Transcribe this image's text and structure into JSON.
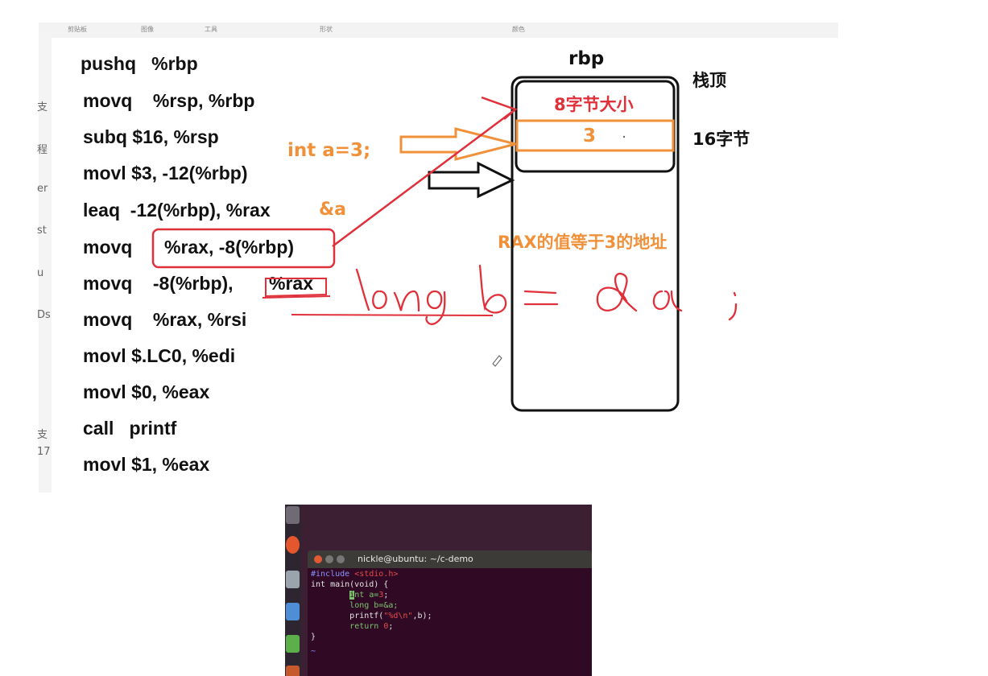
{
  "ribbon": {
    "groups": [
      "剪贴板",
      "图像",
      "工具",
      "形状",
      "颜色"
    ]
  },
  "sidebar_fragments": [
    "支",
    "程",
    "er",
    "st",
    "u",
    "Ds",
    "支",
    "17"
  ],
  "assembly": [
    "pushq   %rbp",
    "movq    %rsp, %rbp",
    "subq $16, %rsp",
    "movl $3, -12(%rbp)",
    "leaq  -12(%rbp), %rax",
    "movq",
    "%rax, -8(%rbp)",
    "movq    -8(%rbp),",
    "%rax",
    "movq    %rax, %rsi",
    "movl $.LC0, %edi",
    "movl $0, %eax",
    "call   printf",
    "movl $1, %eax"
  ],
  "annotations": {
    "int_a": "int a=3;",
    "addr_a": "&a",
    "rax_note": "RAX的值等于3的地址",
    "handwriting": "long b = &a ;"
  },
  "stack": {
    "top_label": "rbp",
    "stack_top": "栈顶",
    "slot_size": "8字节大小",
    "slot_value": "3",
    "size_label": "16字节"
  },
  "terminal": {
    "title": "nickle@ubuntu: ~/c-demo",
    "lines": [
      {
        "pre": "#include ",
        "str": "<stdio.h>"
      },
      {
        "text": "int main(void) {"
      },
      {
        "indent": "        ",
        "cur": "i",
        "text": "nt a=",
        "num": "3",
        "end": ";"
      },
      {
        "indent": "        ",
        "text": "long b=&a;"
      },
      {
        "indent": "        ",
        "text": "printf(",
        "str": "\"%d\\n\"",
        "end": ",b);"
      },
      {
        "indent": "        ",
        "kw": "return ",
        "num": "0",
        "end": ";"
      },
      {
        "text": "}"
      },
      {
        "text": "~"
      }
    ]
  },
  "colors": {
    "annotation_red": "#e0303a",
    "annotation_orange": "#f0913a",
    "terminal_bg": "#300a24"
  }
}
